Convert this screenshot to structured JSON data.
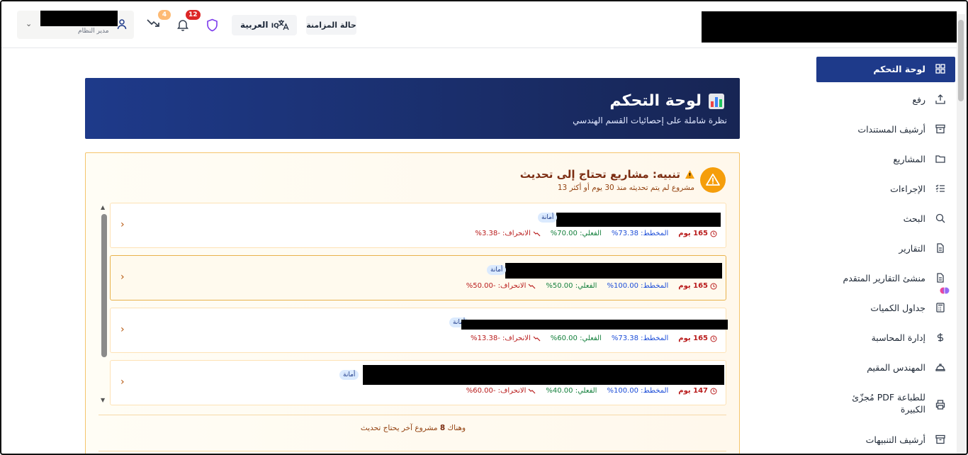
{
  "header": {
    "user": {
      "role": "مدير النظام",
      "chevron": "⌄",
      "icon": "user-icon"
    },
    "trend_badge": "4",
    "notifications_badge": "12",
    "language": {
      "label": "العربية",
      "prefix": "IQ"
    },
    "sync_status_label": "حالة المزامنة"
  },
  "sidebar": {
    "items": [
      {
        "label": "لوحة التحكم",
        "icon": "dashboard-grid-icon"
      },
      {
        "label": "رفع",
        "icon": "upload-icon"
      },
      {
        "label": "أرشيف المستندات",
        "icon": "archive-icon"
      },
      {
        "label": "المشاريع",
        "icon": "folder-icon"
      },
      {
        "label": "الإجراءات",
        "icon": "checklist-icon"
      },
      {
        "label": "البحث",
        "icon": "search-icon"
      },
      {
        "label": "التقارير",
        "icon": "file-icon"
      },
      {
        "label": "منشئ التقارير المتقدم",
        "icon": "file-icon"
      },
      {
        "label": "جداول الكميات",
        "icon": "calculator-icon"
      },
      {
        "label": "إدارة المحاسبة",
        "icon": "dollar-icon"
      },
      {
        "label": "المهندس المقيم",
        "icon": "hardhat-icon"
      },
      {
        "label": "مُجزّئ PDF للطباعة الكبيرة",
        "icon": "printer-icon"
      },
      {
        "label": "أرشيف التنبيهات",
        "icon": "archive-icon"
      }
    ]
  },
  "hero": {
    "title": "لوحة التحكم",
    "subtitle": "نظرة شاملة على إحصائيات القسم الهندسي"
  },
  "alert": {
    "title": "تنبيه: مشاريع تحتاج إلى تحديث",
    "subtitle": "13 مشروع لم يتم تحديثه منذ 30 يوم أو أكثر",
    "projects": [
      {
        "tag": "أمانة",
        "days": "165 يوم",
        "planned": "المخطط: 73.38%",
        "actual": "الفعلي: 70.00%",
        "deviation": "الانحراف: -3.38%"
      },
      {
        "tag": "أمانة",
        "days": "165 يوم",
        "planned": "المخطط: 100.00%",
        "actual": "الفعلي: 50.00%",
        "deviation": "الانحراف: -50.00%"
      },
      {
        "tag": "أمانة",
        "days": "165 يوم",
        "planned": "المخطط: 73.38%",
        "actual": "الفعلي: 60.00%",
        "deviation": "الانحراف: -13.38%"
      },
      {
        "tag": "أمانة",
        "days": "147 يوم",
        "planned": "المخطط: 100.00%",
        "actual": "الفعلي: 40.00%",
        "deviation": "الانحراف: -60.00%"
      }
    ],
    "more_prefix": "وهناك",
    "more_count": "8",
    "more_suffix": "مشروع آخر يحتاج تحديث"
  },
  "colors": {
    "primary": "#1e3a8a",
    "warning": "#f59e0b",
    "badge_red": "#dc2626",
    "badge_orange": "#fdba74",
    "danger_text": "#b91c1c",
    "plan_text": "#1d4ed8",
    "actual_text": "#15803d"
  }
}
